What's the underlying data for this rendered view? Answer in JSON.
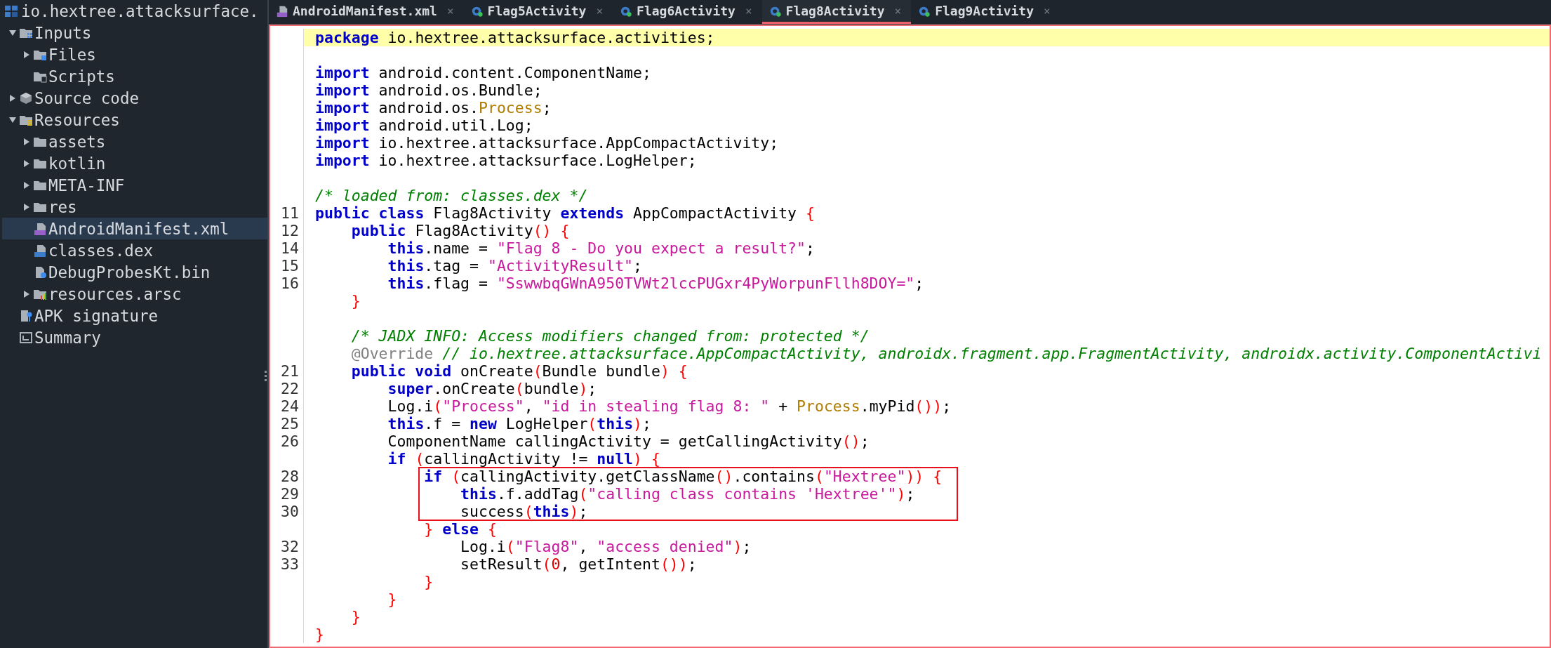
{
  "project": {
    "title": "io.hextree.attacksurface."
  },
  "tree": [
    {
      "label": "Inputs",
      "kind": "inputs",
      "expanded": true,
      "selected": false,
      "children": [
        {
          "label": "Files",
          "kind": "files",
          "expanded": false,
          "selected": false
        },
        {
          "label": "Scripts",
          "kind": "scripts",
          "selected": false
        }
      ]
    },
    {
      "label": "Source code",
      "kind": "source",
      "expanded": false,
      "selected": false
    },
    {
      "label": "Resources",
      "kind": "resources",
      "expanded": true,
      "selected": false,
      "children": [
        {
          "label": "assets",
          "kind": "folder",
          "expanded": false,
          "selected": false
        },
        {
          "label": "kotlin",
          "kind": "folder",
          "expanded": false,
          "selected": false
        },
        {
          "label": "META-INF",
          "kind": "folder",
          "expanded": false,
          "selected": false
        },
        {
          "label": "res",
          "kind": "folder",
          "expanded": false,
          "selected": false
        },
        {
          "label": "AndroidManifest.xml",
          "kind": "manifest",
          "selected": true
        },
        {
          "label": "classes.dex",
          "kind": "dex",
          "selected": false
        },
        {
          "label": "DebugProbesKt.bin",
          "kind": "unknown",
          "selected": false
        },
        {
          "label": "resources.arsc",
          "kind": "arsc",
          "expanded": false,
          "selected": false
        }
      ]
    },
    {
      "label": "APK signature",
      "kind": "signature",
      "selected": false
    },
    {
      "label": "Summary",
      "kind": "summary",
      "selected": false
    }
  ],
  "tabs": [
    {
      "label": "AndroidManifest.xml",
      "kind": "manifest",
      "selected": false,
      "close": "×"
    },
    {
      "label": "Flag5Activity",
      "kind": "class",
      "selected": false,
      "close": "×"
    },
    {
      "label": "Flag6Activity",
      "kind": "class",
      "selected": false,
      "close": "×"
    },
    {
      "label": "Flag8Activity",
      "kind": "class",
      "selected": true,
      "close": "×"
    },
    {
      "label": "Flag9Activity",
      "kind": "class",
      "selected": false,
      "close": "×"
    }
  ],
  "code": {
    "lines": [
      {
        "highlighted": true,
        "boxed": false,
        "tokens": [
          {
            "kind": "keyword",
            "text": "package"
          },
          {
            "kind": "plain",
            "text": " io.hextree.attacksurface.activities;"
          }
        ]
      },
      {
        "highlighted": false,
        "boxed": false
      },
      {
        "highlighted": false,
        "boxed": false,
        "tokens": [
          {
            "kind": "keyword",
            "text": "import"
          },
          {
            "kind": "plain",
            "text": " android.content.ComponentName;"
          }
        ]
      },
      {
        "highlighted": false,
        "boxed": false,
        "tokens": [
          {
            "kind": "keyword",
            "text": "import"
          },
          {
            "kind": "plain",
            "text": " android.os.Bundle;"
          }
        ]
      },
      {
        "highlighted": false,
        "boxed": false,
        "tokens": [
          {
            "kind": "keyword",
            "text": "import"
          },
          {
            "kind": "plain",
            "text": " android.os."
          },
          {
            "kind": "class-ref",
            "text": "Process"
          },
          {
            "kind": "plain",
            "text": ";"
          }
        ]
      },
      {
        "highlighted": false,
        "boxed": false,
        "tokens": [
          {
            "kind": "keyword",
            "text": "import"
          },
          {
            "kind": "plain",
            "text": " android.util.Log;"
          }
        ]
      },
      {
        "highlighted": false,
        "boxed": false,
        "tokens": [
          {
            "kind": "keyword",
            "text": "import"
          },
          {
            "kind": "plain",
            "text": " io.hextree.attacksurface.AppCompactActivity;"
          }
        ]
      },
      {
        "highlighted": false,
        "boxed": false,
        "tokens": [
          {
            "kind": "keyword",
            "text": "import"
          },
          {
            "kind": "plain",
            "text": " io.hextree.attacksurface.LogHelper;"
          }
        ]
      },
      {
        "highlighted": false,
        "boxed": false
      },
      {
        "highlighted": false,
        "boxed": false,
        "tokens": [
          {
            "kind": "comment",
            "text": "/* loaded from: classes.dex */"
          }
        ]
      },
      {
        "number": "11",
        "highlighted": false,
        "boxed": false,
        "tokens": [
          {
            "kind": "keyword",
            "text": "public class"
          },
          {
            "kind": "plain",
            "text": " Flag8Activity "
          },
          {
            "kind": "keyword",
            "text": "extends"
          },
          {
            "kind": "plain",
            "text": " AppCompactActivity"
          },
          {
            "kind": "bracket",
            "text": " {"
          }
        ],
        "children": [
          {
            "number": "12",
            "highlighted": false,
            "boxed": false,
            "tokens": [
              {
                "kind": "keyword",
                "text": "public"
              },
              {
                "kind": "plain",
                "text": " Flag8Activity"
              },
              {
                "kind": "bracket",
                "text": "() {"
              }
            ],
            "children": [
              {
                "number": "14",
                "highlighted": false,
                "boxed": false,
                "tokens": [
                  {
                    "kind": "keyword",
                    "text": "this"
                  },
                  {
                    "kind": "plain",
                    "text": ".name = "
                  },
                  {
                    "kind": "string",
                    "text": "\"Flag 8 - Do you expect a result?\""
                  },
                  {
                    "kind": "plain",
                    "text": ";"
                  }
                ]
              },
              {
                "number": "15",
                "highlighted": false,
                "boxed": false,
                "tokens": [
                  {
                    "kind": "keyword",
                    "text": "this"
                  },
                  {
                    "kind": "plain",
                    "text": ".tag = "
                  },
                  {
                    "kind": "string",
                    "text": "\"ActivityResult\""
                  },
                  {
                    "kind": "plain",
                    "text": ";"
                  }
                ]
              },
              {
                "number": "16",
                "highlighted": false,
                "boxed": false,
                "tokens": [
                  {
                    "kind": "keyword",
                    "text": "this"
                  },
                  {
                    "kind": "plain",
                    "text": ".flag = "
                  },
                  {
                    "kind": "string",
                    "text": "\"SswwbqGWnA950TVWt2lccPUGxr4PyWorpunFllh8DOY=\""
                  },
                  {
                    "kind": "plain",
                    "text": ";"
                  }
                ]
              }
            ]
          },
          {
            "highlighted": false,
            "boxed": false,
            "tokens": [
              {
                "kind": "bracket",
                "text": "}"
              }
            ]
          },
          {
            "highlighted": false,
            "boxed": false
          },
          {
            "highlighted": false,
            "boxed": false,
            "tokens": [
              {
                "kind": "comment",
                "text": "/* JADX INFO: Access modifiers changed from: protected */"
              }
            ]
          },
          {
            "highlighted": false,
            "boxed": false,
            "tokens": [
              {
                "kind": "annotation",
                "text": "@Override"
              },
              {
                "kind": "comment",
                "text": " // io.hextree.attacksurface.AppCompactActivity, androidx.fragment.app.FragmentActivity, androidx.activity.ComponentActivi"
              }
            ]
          },
          {
            "number": "21",
            "highlighted": false,
            "boxed": false,
            "tokens": [
              {
                "kind": "keyword",
                "text": "public void"
              },
              {
                "kind": "plain",
                "text": " onCreate"
              },
              {
                "kind": "bracket",
                "text": "("
              },
              {
                "kind": "plain",
                "text": "Bundle bundle"
              },
              {
                "kind": "bracket",
                "text": ") {"
              }
            ],
            "children": [
              {
                "number": "22",
                "highlighted": false,
                "boxed": false,
                "tokens": [
                  {
                    "kind": "keyword",
                    "text": "super"
                  },
                  {
                    "kind": "plain",
                    "text": ".onCreate"
                  },
                  {
                    "kind": "bracket",
                    "text": "("
                  },
                  {
                    "kind": "plain",
                    "text": "bundle"
                  },
                  {
                    "kind": "bracket",
                    "text": ")"
                  },
                  {
                    "kind": "plain",
                    "text": ";"
                  }
                ]
              },
              {
                "number": "24",
                "highlighted": false,
                "boxed": false,
                "tokens": [
                  {
                    "kind": "plain",
                    "text": "Log.i"
                  },
                  {
                    "kind": "bracket",
                    "text": "("
                  },
                  {
                    "kind": "string",
                    "text": "\"Process\""
                  },
                  {
                    "kind": "plain",
                    "text": ", "
                  },
                  {
                    "kind": "string",
                    "text": "\"id in stealing flag 8: \""
                  },
                  {
                    "kind": "plain",
                    "text": " + "
                  },
                  {
                    "kind": "class-ref",
                    "text": "Process"
                  },
                  {
                    "kind": "plain",
                    "text": ".myPid"
                  },
                  {
                    "kind": "bracket",
                    "text": "())"
                  },
                  {
                    "kind": "plain",
                    "text": ";"
                  }
                ]
              },
              {
                "number": "25",
                "highlighted": false,
                "boxed": false,
                "tokens": [
                  {
                    "kind": "keyword",
                    "text": "this"
                  },
                  {
                    "kind": "plain",
                    "text": ".f = "
                  },
                  {
                    "kind": "keyword",
                    "text": "new"
                  },
                  {
                    "kind": "plain",
                    "text": " LogHelper"
                  },
                  {
                    "kind": "bracket",
                    "text": "("
                  },
                  {
                    "kind": "keyword",
                    "text": "this"
                  },
                  {
                    "kind": "bracket",
                    "text": ")"
                  },
                  {
                    "kind": "plain",
                    "text": ";"
                  }
                ]
              },
              {
                "number": "26",
                "highlighted": false,
                "boxed": false,
                "tokens": [
                  {
                    "kind": "plain",
                    "text": "ComponentName callingActivity = getCallingActivity"
                  },
                  {
                    "kind": "bracket",
                    "text": "()"
                  },
                  {
                    "kind": "plain",
                    "text": ";"
                  }
                ]
              },
              {
                "highlighted": false,
                "boxed": false,
                "tokens": [
                  {
                    "kind": "keyword",
                    "text": "if"
                  },
                  {
                    "kind": "bracket",
                    "text": " ("
                  },
                  {
                    "kind": "plain",
                    "text": "callingActivity != "
                  },
                  {
                    "kind": "keyword",
                    "text": "null"
                  },
                  {
                    "kind": "bracket",
                    "text": ") {"
                  }
                ],
                "children": [
                  {
                    "number": "28",
                    "highlighted": false,
                    "boxed": true,
                    "tokens": [
                      {
                        "kind": "keyword",
                        "text": "if"
                      },
                      {
                        "kind": "bracket",
                        "text": " ("
                      },
                      {
                        "kind": "plain",
                        "text": "callingActivity.getClassName"
                      },
                      {
                        "kind": "bracket",
                        "text": "()"
                      },
                      {
                        "kind": "plain",
                        "text": ".contains"
                      },
                      {
                        "kind": "bracket",
                        "text": "("
                      },
                      {
                        "kind": "string",
                        "text": "\"Hextree\""
                      },
                      {
                        "kind": "bracket",
                        "text": ")) {"
                      }
                    ],
                    "children": [
                      {
                        "number": "29",
                        "highlighted": false,
                        "boxed": true,
                        "tokens": [
                          {
                            "kind": "keyword",
                            "text": "this"
                          },
                          {
                            "kind": "plain",
                            "text": ".f.addTag"
                          },
                          {
                            "kind": "bracket",
                            "text": "("
                          },
                          {
                            "kind": "string",
                            "text": "\"calling class contains 'Hextree'\""
                          },
                          {
                            "kind": "bracket",
                            "text": ")"
                          },
                          {
                            "kind": "plain",
                            "text": ";"
                          }
                        ]
                      },
                      {
                        "number": "30",
                        "highlighted": false,
                        "boxed": true,
                        "tokens": [
                          {
                            "kind": "plain",
                            "text": "success"
                          },
                          {
                            "kind": "bracket",
                            "text": "("
                          },
                          {
                            "kind": "keyword",
                            "text": "this"
                          },
                          {
                            "kind": "bracket",
                            "text": ")"
                          },
                          {
                            "kind": "plain",
                            "text": ";"
                          }
                        ]
                      }
                    ]
                  },
                  {
                    "highlighted": false,
                    "boxed": false,
                    "tokens": [
                      {
                        "kind": "bracket",
                        "text": "} "
                      },
                      {
                        "kind": "keyword",
                        "text": "else"
                      },
                      {
                        "kind": "bracket",
                        "text": " {"
                      }
                    ],
                    "children": [
                      {
                        "number": "32",
                        "highlighted": false,
                        "boxed": false,
                        "tokens": [
                          {
                            "kind": "plain",
                            "text": "Log.i"
                          },
                          {
                            "kind": "bracket",
                            "text": "("
                          },
                          {
                            "kind": "string",
                            "text": "\"Flag8\""
                          },
                          {
                            "kind": "plain",
                            "text": ", "
                          },
                          {
                            "kind": "string",
                            "text": "\"access denied\""
                          },
                          {
                            "kind": "bracket",
                            "text": ")"
                          },
                          {
                            "kind": "plain",
                            "text": ";"
                          }
                        ]
                      },
                      {
                        "number": "33",
                        "highlighted": false,
                        "boxed": false,
                        "tokens": [
                          {
                            "kind": "plain",
                            "text": "setResult"
                          },
                          {
                            "kind": "bracket",
                            "text": "("
                          },
                          {
                            "kind": "number",
                            "text": "0"
                          },
                          {
                            "kind": "plain",
                            "text": ", getIntent"
                          },
                          {
                            "kind": "bracket",
                            "text": "())"
                          },
                          {
                            "kind": "plain",
                            "text": ";"
                          }
                        ]
                      }
                    ]
                  },
                  {
                    "highlighted": false,
                    "boxed": false,
                    "tokens": [
                      {
                        "kind": "bracket",
                        "text": "}"
                      }
                    ]
                  }
                ]
              },
              {
                "highlighted": false,
                "boxed": false,
                "tokens": [
                  {
                    "kind": "bracket",
                    "text": "}"
                  }
                ]
              }
            ]
          },
          {
            "highlighted": false,
            "boxed": false,
            "tokens": [
              {
                "kind": "bracket",
                "text": "}"
              }
            ]
          }
        ]
      },
      {
        "highlighted": false,
        "boxed": false,
        "tokens": [
          {
            "kind": "bracket",
            "text": "}"
          }
        ]
      }
    ]
  }
}
